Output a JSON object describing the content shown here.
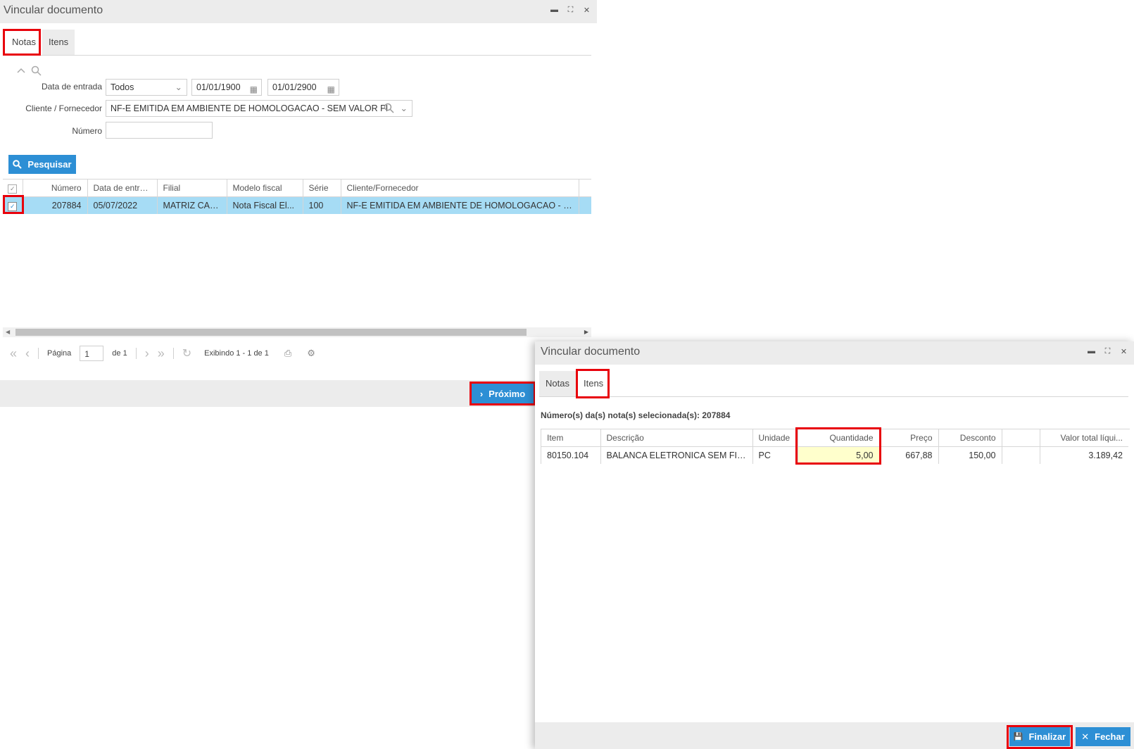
{
  "win1": {
    "title": "Vincular documento",
    "tabs": [
      "Notas",
      "Itens"
    ],
    "filters": {
      "data_entrada_label": "Data de entrada",
      "periodo_value": "Todos",
      "date_from": "01/01/1900",
      "date_to": "01/01/2900",
      "cliente_label": "Cliente / Fornecedor",
      "cliente_value": "NF-E EMITIDA EM AMBIENTE DE HOMOLOGACAO - SEM VALOR FI",
      "numero_label": "Número",
      "numero_value": ""
    },
    "search_button": "Pesquisar",
    "grid": {
      "columns": [
        "Número",
        "Data de entra...",
        "Filial",
        "Modelo fiscal",
        "Série",
        "Cliente/Fornecedor"
      ],
      "rows": [
        [
          "207884",
          "05/07/2022",
          "MATRIZ CAX...",
          "Nota Fiscal El...",
          "100",
          "NF-E EMITIDA EM AMBIENTE DE HOMOLOGACAO - SE..."
        ]
      ]
    },
    "pager": {
      "page_label": "Página",
      "page_value": "1",
      "of_label": "de 1",
      "showing": "Exibindo 1 - 1 de 1"
    },
    "next_button": "Próximo"
  },
  "win2": {
    "title": "Vincular documento",
    "tabs": [
      "Notas",
      "Itens"
    ],
    "selected_notes": "Número(s) da(s) nota(s) selecionada(s): 207884",
    "grid": {
      "columns": [
        "Item",
        "Descrição",
        "Unidade",
        "Quantidade",
        "Preço",
        "Desconto",
        "",
        "Valor total líqui..."
      ],
      "rows": [
        [
          "80150.104",
          "BALANCA ELETRONICA SEM FIO ...",
          "PC",
          "5,00",
          "667,88",
          "150,00",
          "",
          "3.189,42"
        ]
      ]
    },
    "finish_button": "Finalizar",
    "close_button": "Fechar"
  },
  "colors": {
    "accent_blue": "#2d8fd5",
    "selected_row": "#a6dcf5",
    "highlight_red": "#e8000b",
    "editable_cell": "#ffffcc"
  }
}
